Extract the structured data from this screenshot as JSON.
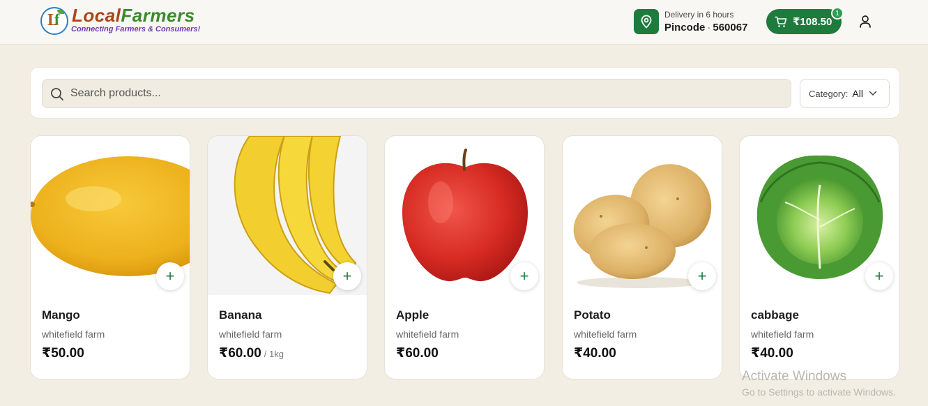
{
  "header": {
    "logo_local": "Local",
    "logo_farmers": "Farmers",
    "logo_tagline": "Connecting Farmers & Consumers!",
    "delivery_text": "Delivery in 6 hours",
    "pincode_label": "Pincode",
    "pincode_value": "560067",
    "cart_total": "₹108.50",
    "cart_count": "1",
    "icons": [
      "location-pin-icon",
      "cart-icon",
      "user-icon"
    ]
  },
  "search": {
    "placeholder": "Search products...",
    "category_label": "Category:",
    "category_value": "All"
  },
  "products": [
    {
      "name": "Mango",
      "farm": "whitefield farm",
      "price": "₹50.00",
      "unit": ""
    },
    {
      "name": "Banana",
      "farm": "whitefield farm",
      "price": "₹60.00",
      "unit": "/ 1kg"
    },
    {
      "name": "Apple",
      "farm": "whitefield farm",
      "price": "₹60.00",
      "unit": ""
    },
    {
      "name": "Potato",
      "farm": "whitefield farm",
      "price": "₹40.00",
      "unit": ""
    },
    {
      "name": "cabbage",
      "farm": "whitefield farm",
      "price": "₹40.00",
      "unit": ""
    }
  ],
  "watermark": {
    "title": "Activate Windows",
    "subtitle": "Go to Settings to activate Windows."
  },
  "colors": {
    "brand_green": "#1f7a3e",
    "page_bg": "#f3eee4"
  }
}
